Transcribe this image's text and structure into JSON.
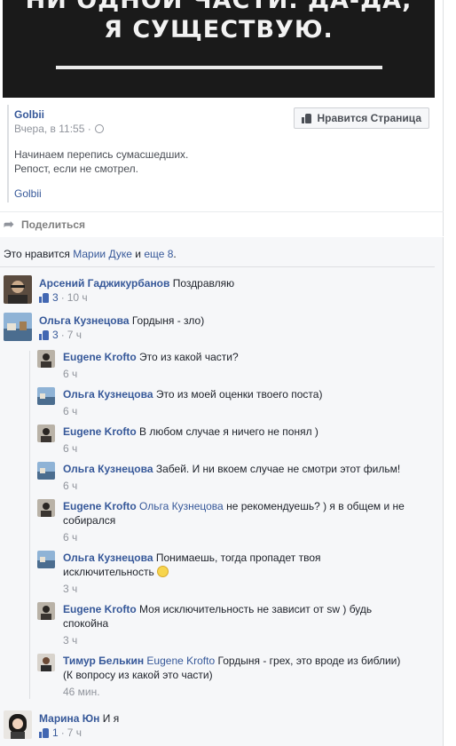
{
  "hero": {
    "line1": "НИ ОДНОЙ ЧАСТИ. ДА-ДА,",
    "line2": "Я СУЩЕСТВУЮ."
  },
  "shared_post": {
    "page_name": "Golbii",
    "time": "Вчера, в 11:55 ·",
    "text_line1": "Начинаем перепись сумасшедших.",
    "text_line2": "Репост, если не смотрел.",
    "link": "Golbii",
    "like_page_label": "Нравится Страница"
  },
  "actions": {
    "share_label": "Поделиться"
  },
  "likes": {
    "prefix": "Это нравится",
    "name": "Марии Дуке",
    "middle": "и",
    "more": "еще 8",
    "suffix": "."
  },
  "comments": [
    {
      "author": "Арсений Гаджикурбанов",
      "text": "Поздравляю",
      "likes": "3",
      "time": "10 ч",
      "avatar": "avatar-arseniy"
    },
    {
      "author": "Ольга Кузнецова",
      "text": "Гордыня - зло)",
      "likes": "3",
      "time": "7 ч",
      "avatar": "avatar-olga"
    },
    {
      "author": "Марина Юн",
      "text": "И я",
      "likes": "1",
      "time": "7 ч",
      "avatar": "avatar-marina"
    }
  ],
  "replies": [
    {
      "author": "Eugene Krofto",
      "mention": "",
      "line1": "Это из какой части?",
      "line2": "",
      "time": "6 ч"
    },
    {
      "author": "Ольга Кузнецова",
      "mention": "",
      "line1": "Это из моей оценки твоего поста)",
      "line2": "",
      "time": "6 ч"
    },
    {
      "author": "Eugene Krofto",
      "mention": "",
      "line1": "В любом случае я ничего не понял )",
      "line2": "",
      "time": "6 ч"
    },
    {
      "author": "Ольга Кузнецова",
      "mention": "",
      "line1": "Забей. И ни вкоем случае не смотри этот фильм!",
      "line2": "",
      "time": "6 ч"
    },
    {
      "author": "Eugene Krofto",
      "mention": "Ольга Кузнецова",
      "line1": "не рекомендуешь? ) я в общем и не",
      "line2": "собирался",
      "time": "6 ч"
    },
    {
      "author": "Ольга Кузнецова",
      "mention": "",
      "line1": "Понимаешь, тогда пропадет твоя",
      "line2": "исключительность",
      "time": "3 ч"
    },
    {
      "author": "Eugene Krofto",
      "mention": "",
      "line1": "Моя исключительность не зависит от sw ) будь",
      "line2": "спокойна",
      "time": "3 ч"
    },
    {
      "author": "Тимур Белькин",
      "mention": "Eugene Krofto",
      "line1": "Гордыня - грех, это вроде из библии)",
      "line2": "(К вопросу из какой это части)",
      "time": "46 мин."
    }
  ],
  "colors": {
    "link": "#365899",
    "meta": "#90949c",
    "background": "#f6f7f9",
    "like_blue": "#4267b2"
  }
}
